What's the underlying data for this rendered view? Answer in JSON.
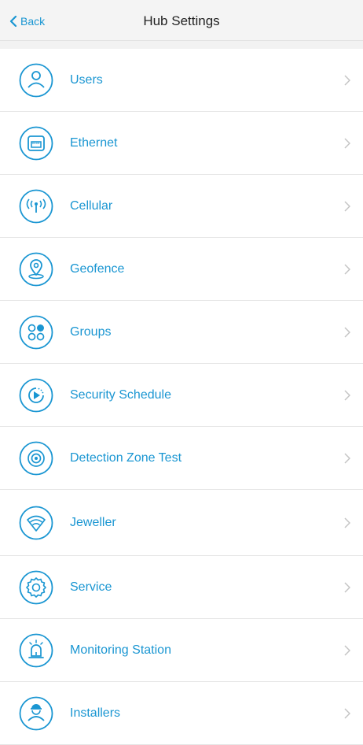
{
  "header": {
    "back_label": "Back",
    "title": "Hub Settings"
  },
  "colors": {
    "accent": "#1a96d2",
    "highlight": "#1de3a5",
    "chevron": "#c4c4c4"
  },
  "items": [
    {
      "label": "Users",
      "icon": "user-icon"
    },
    {
      "label": "Ethernet",
      "icon": "ethernet-icon"
    },
    {
      "label": "Cellular",
      "icon": "cellular-icon"
    },
    {
      "label": "Geofence",
      "icon": "geofence-icon"
    },
    {
      "label": "Groups",
      "icon": "groups-icon"
    },
    {
      "label": "Security Schedule",
      "icon": "security-schedule-icon"
    },
    {
      "label": "Detection Zone Test",
      "icon": "detection-zone-icon"
    },
    {
      "label": "Jeweller",
      "icon": "jeweller-icon",
      "highlighted": true
    },
    {
      "label": "Service",
      "icon": "service-gear-icon"
    },
    {
      "label": "Monitoring Station",
      "icon": "monitoring-station-icon"
    },
    {
      "label": "Installers",
      "icon": "installer-icon"
    }
  ]
}
